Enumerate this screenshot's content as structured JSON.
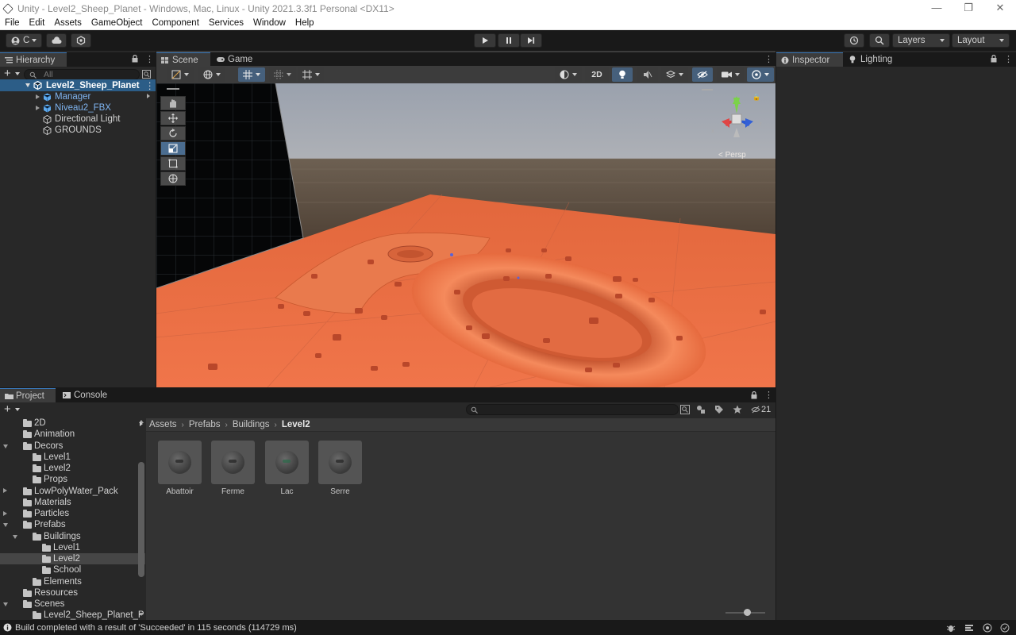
{
  "window": {
    "title": "Unity - Level2_Sheep_Planet - Windows, Mac, Linux - Unity 2021.3.3f1 Personal <DX11>",
    "minimize": "—",
    "maximize": "❐",
    "close": "✕"
  },
  "menu": [
    "File",
    "Edit",
    "Assets",
    "GameObject",
    "Component",
    "Services",
    "Window",
    "Help"
  ],
  "toolbar": {
    "account_label": "C",
    "layers_label": "Layers",
    "layout_label": "Layout"
  },
  "hierarchy": {
    "tab_label": "Hierarchy",
    "search_placeholder": "All",
    "scene_name": "Level2_Sheep_Planet",
    "items": [
      {
        "label": "Manager",
        "prefab": true
      },
      {
        "label": "Niveau2_FBX",
        "prefab": true
      },
      {
        "label": "Directional Light",
        "prefab": false
      },
      {
        "label": "GROUNDS",
        "prefab": false
      }
    ]
  },
  "scene": {
    "tab_scene": "Scene",
    "tab_game": "Game",
    "btn_2d": "2D",
    "persp_label": "< Persp"
  },
  "inspector": {
    "tab_inspector": "Inspector",
    "tab_lighting": "Lighting"
  },
  "project": {
    "tab_project": "Project",
    "tab_console": "Console",
    "hidden_count": "21",
    "breadcrumb": [
      "Assets",
      "Prefabs",
      "Buildings",
      "Level2"
    ],
    "tree": [
      {
        "label": "2D",
        "depth": 0,
        "fold": "none"
      },
      {
        "label": "Animation",
        "depth": 0,
        "fold": "none"
      },
      {
        "label": "Decors",
        "depth": 0,
        "fold": "open"
      },
      {
        "label": "Level1",
        "depth": 1,
        "fold": "none"
      },
      {
        "label": "Level2",
        "depth": 1,
        "fold": "none"
      },
      {
        "label": "Props",
        "depth": 1,
        "fold": "none"
      },
      {
        "label": "LowPolyWater_Pack",
        "depth": 0,
        "fold": "closed"
      },
      {
        "label": "Materials",
        "depth": 0,
        "fold": "none"
      },
      {
        "label": "Particles",
        "depth": 0,
        "fold": "closed"
      },
      {
        "label": "Prefabs",
        "depth": 0,
        "fold": "open"
      },
      {
        "label": "Buildings",
        "depth": 1,
        "fold": "open"
      },
      {
        "label": "Level1",
        "depth": 2,
        "fold": "none"
      },
      {
        "label": "Level2",
        "depth": 2,
        "fold": "none",
        "selected": true
      },
      {
        "label": "School",
        "depth": 2,
        "fold": "none"
      },
      {
        "label": "Elements",
        "depth": 1,
        "fold": "none"
      },
      {
        "label": "Resources",
        "depth": 0,
        "fold": "none"
      },
      {
        "label": "Scenes",
        "depth": 0,
        "fold": "open"
      },
      {
        "label": "Level2_Sheep_Planet_P",
        "depth": 1,
        "fold": "none"
      }
    ],
    "assets": [
      {
        "name": "Abattoir"
      },
      {
        "name": "Ferme"
      },
      {
        "name": "Lac"
      },
      {
        "name": "Serre"
      }
    ]
  },
  "status": {
    "message": "Build completed with a result of 'Succeeded' in 115 seconds (114729 ms)"
  },
  "colors": {
    "selection": "#2c5d87",
    "accent": "#3a79bb",
    "terrain": "#e36a3e"
  }
}
